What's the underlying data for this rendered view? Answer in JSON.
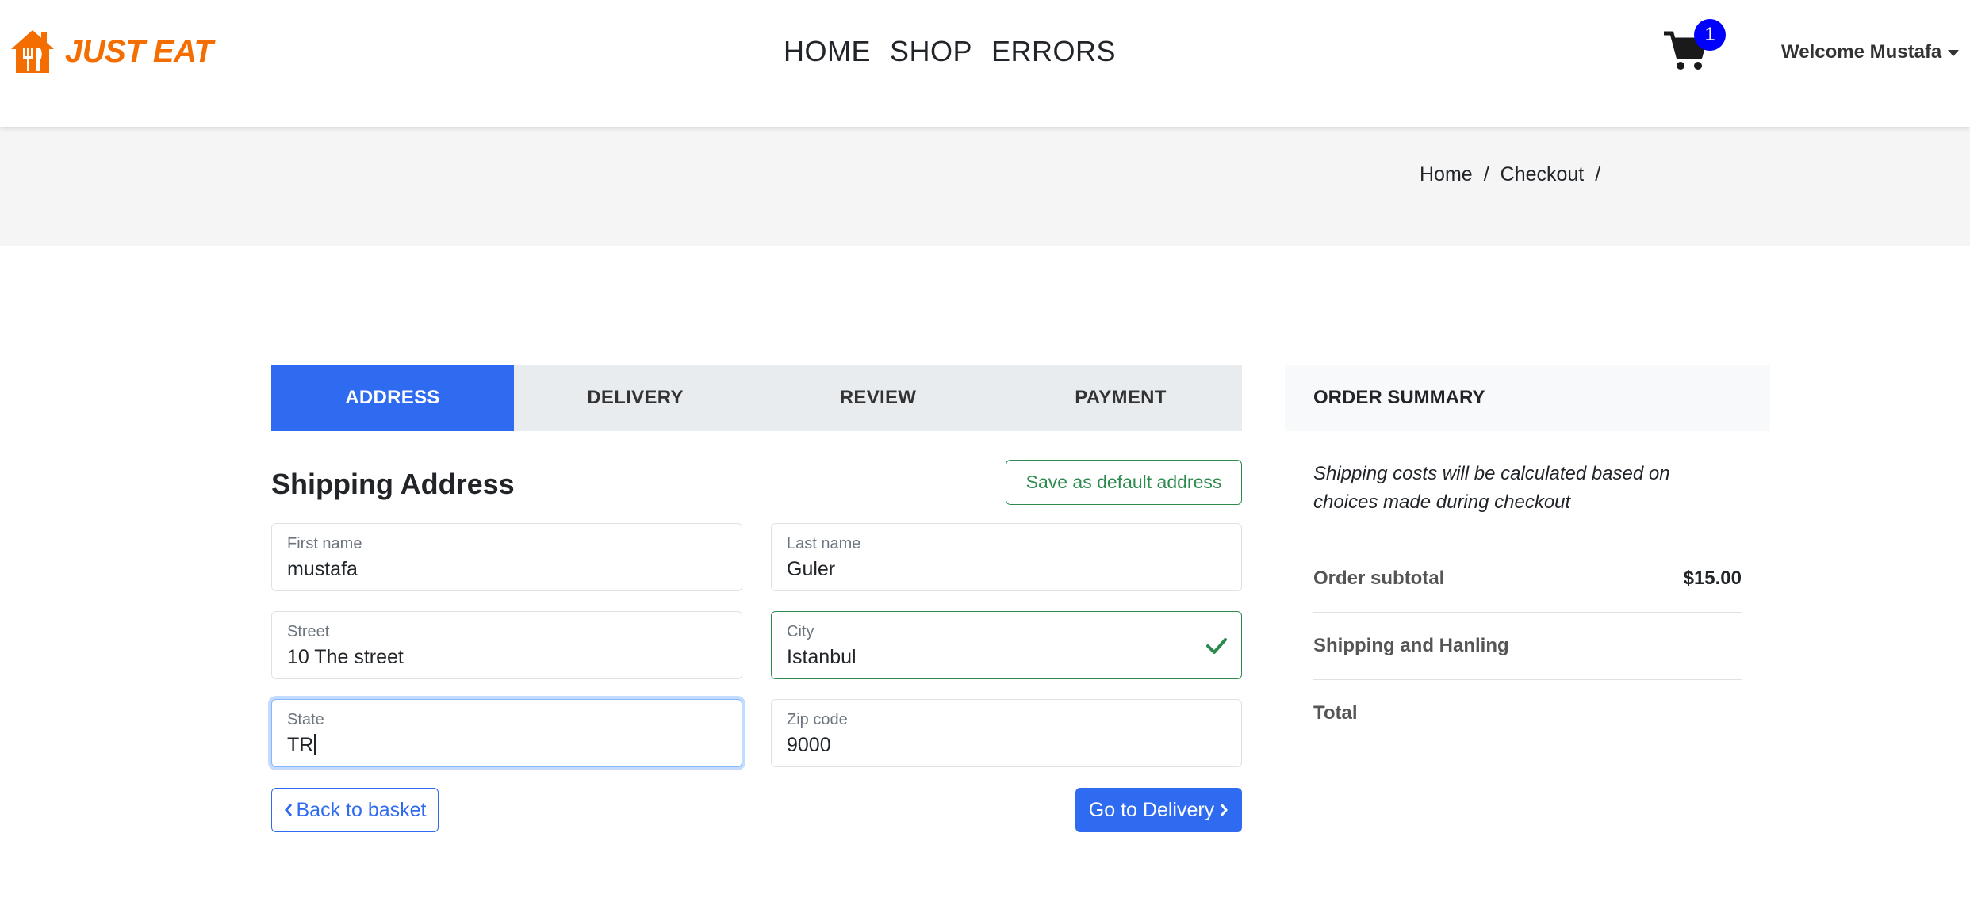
{
  "brand": {
    "name": "JUST EAT",
    "color": "#f36d00"
  },
  "nav": {
    "items": [
      "HOME",
      "SHOP",
      "ERRORS"
    ]
  },
  "cart": {
    "count": "1"
  },
  "user": {
    "welcome": "Welcome Mustafa"
  },
  "breadcrumb": {
    "items": [
      "Home",
      "/",
      "Checkout",
      "/"
    ]
  },
  "steps": [
    "ADDRESS",
    "DELIVERY",
    "REVIEW",
    "PAYMENT"
  ],
  "active_step": "ADDRESS",
  "form": {
    "title": "Shipping Address",
    "save_default_label": "Save as default address",
    "first_name": {
      "label": "First name",
      "value": "mustafa"
    },
    "last_name": {
      "label": "Last name",
      "value": "Guler"
    },
    "street": {
      "label": "Street",
      "value": "10 The street"
    },
    "city": {
      "label": "City",
      "value": "Istanbul"
    },
    "state": {
      "label": "State",
      "value": "TR"
    },
    "zip": {
      "label": "Zip code",
      "value": "9000"
    },
    "back_label": "Back to basket",
    "next_label": "Go to Delivery"
  },
  "summary": {
    "title": "ORDER SUMMARY",
    "note": "Shipping costs will be calculated based on choices made during checkout",
    "rows": [
      {
        "label": "Order subtotal",
        "value": "$15.00"
      },
      {
        "label": "Shipping and Hanling",
        "value": ""
      },
      {
        "label": "Total",
        "value": ""
      }
    ]
  },
  "colors": {
    "primary": "#2f6bf0",
    "success": "#2d8a4e",
    "badge": "#0000ff"
  }
}
